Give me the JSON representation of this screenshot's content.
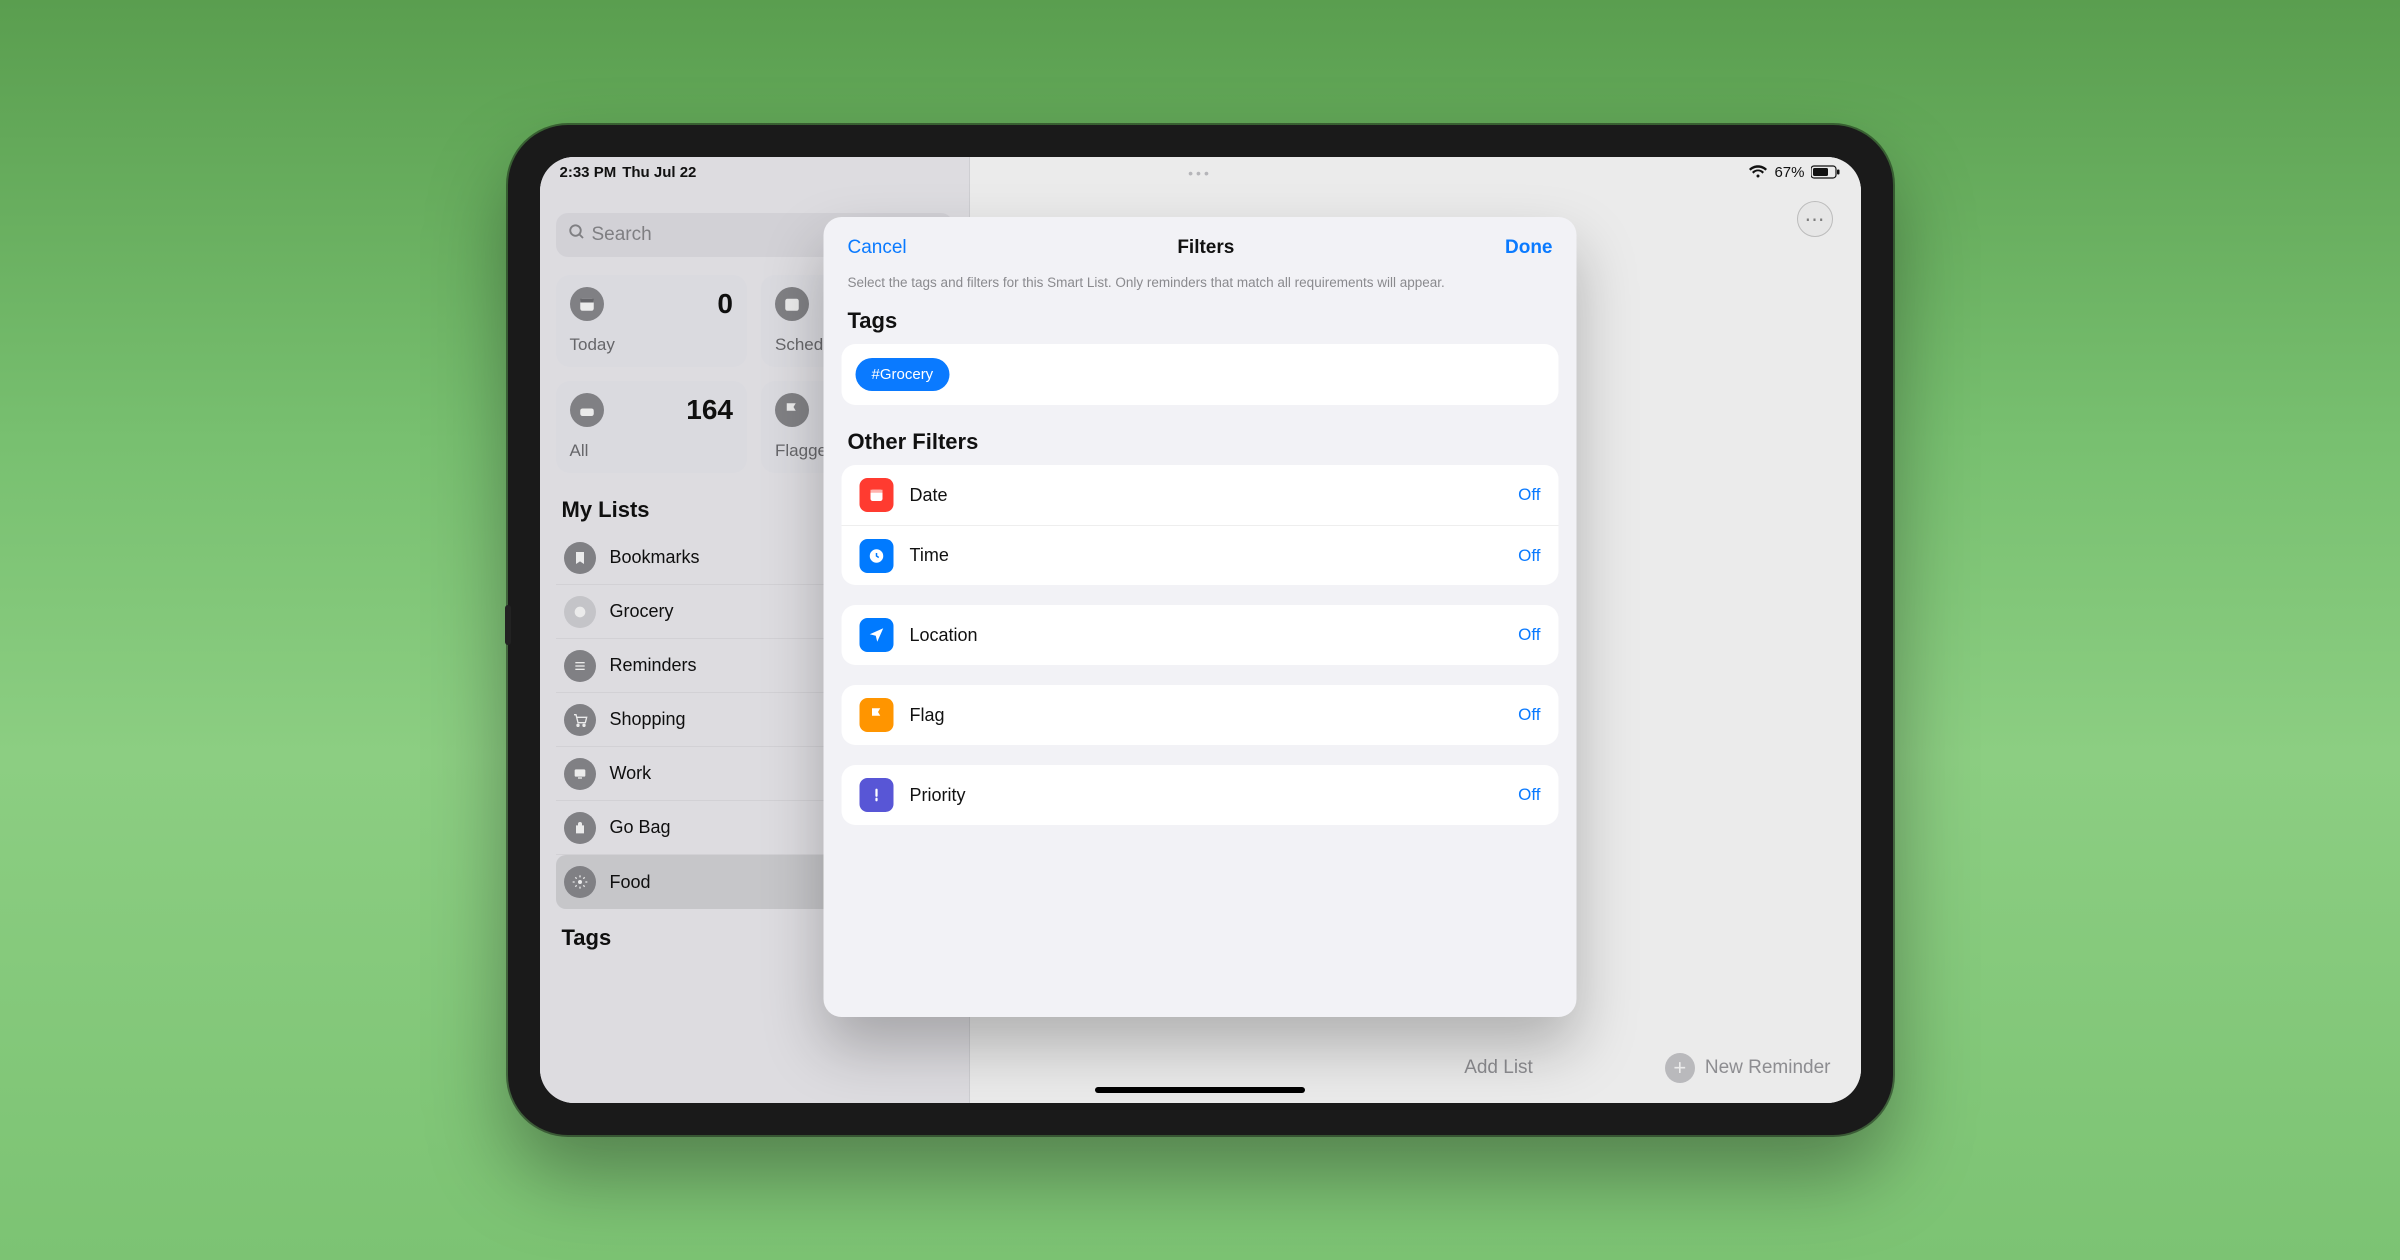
{
  "statusbar": {
    "time": "2:33 PM",
    "date": "Thu Jul 22",
    "battery_pct": "67%"
  },
  "sidebar": {
    "search_placeholder": "Search",
    "cards": [
      {
        "label": "Today",
        "count": "0"
      },
      {
        "label": "Scheduled",
        "count": ""
      },
      {
        "label": "All",
        "count": "164"
      },
      {
        "label": "Flagged",
        "count": ""
      }
    ],
    "lists_title": "My Lists",
    "lists": [
      {
        "label": "Bookmarks"
      },
      {
        "label": "Grocery"
      },
      {
        "label": "Reminders"
      },
      {
        "label": "Shopping"
      },
      {
        "label": "Work"
      },
      {
        "label": "Go Bag"
      },
      {
        "label": "Food"
      }
    ],
    "tags_title": "Tags",
    "add_list": "Add List",
    "new_reminder": "New Reminder"
  },
  "modal": {
    "cancel": "Cancel",
    "title": "Filters",
    "done": "Done",
    "help": "Select the tags and filters for this Smart List. Only reminders that match all requirements will appear.",
    "tags_title": "Tags",
    "tag_chip": "#Grocery",
    "other_filters_title": "Other Filters",
    "filters": {
      "date": {
        "label": "Date",
        "value": "Off"
      },
      "time": {
        "label": "Time",
        "value": "Off"
      },
      "location": {
        "label": "Location",
        "value": "Off"
      },
      "flag": {
        "label": "Flag",
        "value": "Off"
      },
      "priority": {
        "label": "Priority",
        "value": "Off"
      }
    }
  },
  "detail": {
    "more_label": "More options"
  }
}
